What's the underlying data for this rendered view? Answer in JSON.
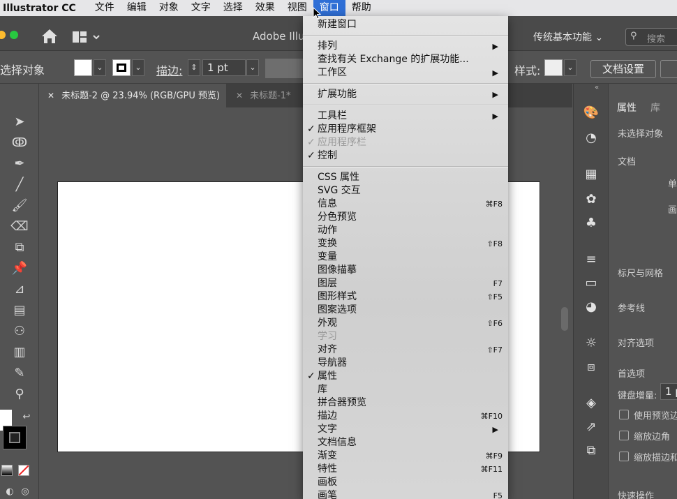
{
  "menubar": {
    "app_name": "Illustrator CC",
    "items": [
      "文件",
      "编辑",
      "对象",
      "文字",
      "选择",
      "效果",
      "视图",
      "窗口",
      "帮助"
    ]
  },
  "titlebar": {
    "title": "Adobe Illu",
    "workspace": "传统基本功能",
    "search_placeholder": "搜索"
  },
  "controlbar": {
    "selection_label": "选择对象",
    "stroke_label": "描边:",
    "stroke_value": "1 pt",
    "style_label": "样式:",
    "doc_settings": "文档设置"
  },
  "tabs": [
    {
      "label": "未标题-2 @ 23.94% (RGB/GPU 预览)"
    },
    {
      "label": "未标题-1*"
    }
  ],
  "menu": {
    "items": [
      {
        "label": "新建窗口",
        "check": "",
        "shortcut": "",
        "arrow": "",
        "disabled": false
      },
      {
        "label": "排列",
        "check": "",
        "shortcut": "",
        "arrow": "▶",
        "disabled": false
      },
      {
        "label": "查找有关 Exchange 的扩展功能...",
        "check": "",
        "shortcut": "",
        "arrow": "",
        "disabled": false
      },
      {
        "label": "工作区",
        "check": "",
        "shortcut": "",
        "arrow": "▶",
        "disabled": false
      },
      {
        "label": "扩展功能",
        "check": "",
        "shortcut": "",
        "arrow": "▶",
        "disabled": false
      },
      {
        "label": "工具栏",
        "check": "",
        "shortcut": "",
        "arrow": "▶",
        "disabled": false
      },
      {
        "label": "应用程序框架",
        "check": "✓",
        "shortcut": "",
        "arrow": "",
        "disabled": false
      },
      {
        "label": "应用程序栏",
        "check": "✓",
        "shortcut": "",
        "arrow": "",
        "disabled": true
      },
      {
        "label": "控制",
        "check": "✓",
        "shortcut": "",
        "arrow": "",
        "disabled": false
      },
      {
        "label": "CSS 属性",
        "check": "",
        "shortcut": "",
        "arrow": "",
        "disabled": false
      },
      {
        "label": "SVG 交互",
        "check": "",
        "shortcut": "",
        "arrow": "",
        "disabled": false
      },
      {
        "label": "信息",
        "check": "",
        "shortcut": "⌘F8",
        "arrow": "",
        "disabled": false
      },
      {
        "label": "分色预览",
        "check": "",
        "shortcut": "",
        "arrow": "",
        "disabled": false
      },
      {
        "label": "动作",
        "check": "",
        "shortcut": "",
        "arrow": "",
        "disabled": false
      },
      {
        "label": "变换",
        "check": "",
        "shortcut": "⇧F8",
        "arrow": "",
        "disabled": false
      },
      {
        "label": "变量",
        "check": "",
        "shortcut": "",
        "arrow": "",
        "disabled": false
      },
      {
        "label": "图像描摹",
        "check": "",
        "shortcut": "",
        "arrow": "",
        "disabled": false
      },
      {
        "label": "图层",
        "check": "",
        "shortcut": "F7",
        "arrow": "",
        "disabled": false
      },
      {
        "label": "图形样式",
        "check": "",
        "shortcut": "⇧F5",
        "arrow": "",
        "disabled": false
      },
      {
        "label": "图案选项",
        "check": "",
        "shortcut": "",
        "arrow": "",
        "disabled": false
      },
      {
        "label": "外观",
        "check": "",
        "shortcut": "⇧F6",
        "arrow": "",
        "disabled": false
      },
      {
        "label": "学习",
        "check": "",
        "shortcut": "",
        "arrow": "",
        "disabled": true
      },
      {
        "label": "对齐",
        "check": "",
        "shortcut": "⇧F7",
        "arrow": "",
        "disabled": false
      },
      {
        "label": "导航器",
        "check": "",
        "shortcut": "",
        "arrow": "",
        "disabled": false
      },
      {
        "label": "属性",
        "check": "✓",
        "shortcut": "",
        "arrow": "",
        "disabled": false
      },
      {
        "label": "库",
        "check": "",
        "shortcut": "",
        "arrow": "",
        "disabled": false
      },
      {
        "label": "拼合器预览",
        "check": "",
        "shortcut": "",
        "arrow": "",
        "disabled": false
      },
      {
        "label": "描边",
        "check": "",
        "shortcut": "⌘F10",
        "arrow": "",
        "disabled": false
      },
      {
        "label": "文字",
        "check": "",
        "shortcut": "",
        "arrow": "▶",
        "disabled": false
      },
      {
        "label": "文档信息",
        "check": "",
        "shortcut": "",
        "arrow": "",
        "disabled": false
      },
      {
        "label": "渐变",
        "check": "",
        "shortcut": "⌘F9",
        "arrow": "",
        "disabled": false
      },
      {
        "label": "特性",
        "check": "",
        "shortcut": "⌘F11",
        "arrow": "",
        "disabled": false
      },
      {
        "label": "画板",
        "check": "",
        "shortcut": "",
        "arrow": "",
        "disabled": false
      },
      {
        "label": "画笔",
        "check": "",
        "shortcut": "F5",
        "arrow": "",
        "disabled": false
      }
    ]
  },
  "properties": {
    "tab_properties": "属性",
    "tab_library": "库",
    "no_selection": "未选择对象",
    "document": "文档",
    "unit_prefix": "单",
    "artboard_prefix": "画",
    "rulers_grids": "标尺与网格",
    "guides": "参考线",
    "snap_options": "对齐选项",
    "preferences": "首选项",
    "keyboard_increment": "键盘增量:",
    "increment_value": "1 p",
    "use_preview_bounds": "使用预览边",
    "scale_corners": "缩放边角",
    "scale_strokes": "缩放描边和",
    "quick_actions": "快速操作"
  },
  "colors": {
    "accent": "#2f6fd6",
    "traffic_red": "#ff5f57",
    "traffic_yellow": "#febc2e",
    "traffic_green": "#28c840"
  }
}
